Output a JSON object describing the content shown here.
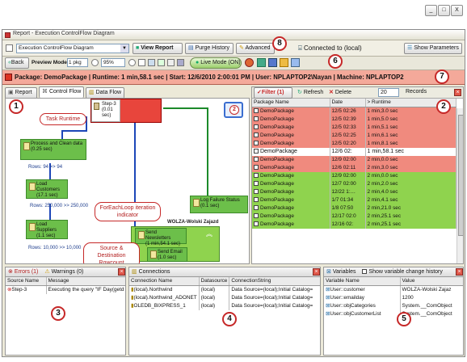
{
  "window_controls": {
    "minimize": "_",
    "maximize": "□",
    "close": "X"
  },
  "window": {
    "title": "Report - Execution ControlFlow Diagram"
  },
  "toolbar1": {
    "report_select": "Execution ControlFlow Diagram",
    "view_report": "View Report",
    "purge_history": "Purge History",
    "advanced": "Advanced",
    "connected": "Connected to (local)",
    "show_parameters": "Show Parameters"
  },
  "toolbar2": {
    "back": "Back",
    "preview_mode": "Preview Mode",
    "page_select": "1 pkg",
    "zoom": "95%",
    "live_mode": "Live Mode (ON)"
  },
  "status_bar": {
    "text": "Package: DemoPackage | Runtime: 1 min,58.1 sec | Start: 12/6/2010 2:00:01 PM | User: NPLAPTOP2\\Nayan | Machine: NPLAPTOP2"
  },
  "tabs": [
    {
      "label": "Report"
    },
    {
      "label": "Control Flow"
    },
    {
      "label": "Data Flow"
    }
  ],
  "callouts": {
    "c1": "1",
    "c2": "2",
    "c3": "3",
    "c4": "4",
    "c5": "5",
    "c6": "6",
    "c7": "7",
    "c8": "8"
  },
  "annotations": {
    "task_runtime": "Task Runtime",
    "foreach": "ForEachLoop iteration indicator",
    "rowcount": "Source & Destination Rowcount"
  },
  "diagram": {
    "step3": "Step-3",
    "step3_time": "(0.01 sec)",
    "step3_badge": "2",
    "tasks": [
      {
        "label": "Process and Clean data",
        "time": "(0.25 sec)"
      },
      {
        "label": "Load Customers",
        "time": "(17.1 sec)"
      },
      {
        "label": "Load Suppliers",
        "time": "(1.1 sec)"
      },
      {
        "label": "Log Failure Status",
        "time": "(0.1 sec)"
      },
      {
        "label": "Send Newsletters",
        "time": "(1 min,54.1 sec)"
      },
      {
        "label": "Send Email",
        "time": "(1.0 sec)"
      }
    ],
    "rows1": "Rows: 94 >> 94",
    "rows2": "Rows: 250,000 >> 250,000",
    "rows3": "Rows: 10,000 >> 10,000",
    "foreach_value": "WOLZA-Wolski Zajazd"
  },
  "history": {
    "filter": "Filter (1)",
    "refresh": "Refresh",
    "delete": "Delete",
    "records_count": "20",
    "records_label": "Records",
    "columns": [
      "Package Name",
      "Date",
      "> Runtime"
    ],
    "rows": [
      {
        "name": "DemoPackage",
        "date": "12/5 02:26",
        "runtime": "1 min,3.0 sec",
        "status": "fail"
      },
      {
        "name": "DemoPackage",
        "date": "12/5 02:39",
        "runtime": "1 min,5.0 sec",
        "status": "fail"
      },
      {
        "name": "DemoPackage",
        "date": "12/5 02:33",
        "runtime": "1 min,5.1 sec",
        "status": "fail"
      },
      {
        "name": "DemoPackage",
        "date": "12/5 02:25",
        "runtime": "1 min,6.1 sec",
        "status": "fail"
      },
      {
        "name": "DemoPackage",
        "date": "12/5 02:20",
        "runtime": "1 min,8.1 sec",
        "status": "fail"
      },
      {
        "name": "DemoPackage",
        "date": "12/6 02:",
        "runtime": "1 min,58.1 sec",
        "status": "current"
      },
      {
        "name": "DemoPackage",
        "date": "12/9 02:00",
        "runtime": "2 min,0.0 sec",
        "status": "fail"
      },
      {
        "name": "DemoPackage",
        "date": "12/6 02:11",
        "runtime": "2 min,3.0 sec",
        "status": "fail"
      },
      {
        "name": "DemoPackage",
        "date": "12/9 02:00",
        "runtime": "2 min,0.0 sec",
        "status": "ok"
      },
      {
        "name": "DemoPackage",
        "date": "12/7 02:00",
        "runtime": "2 min,2.0 sec",
        "status": "ok"
      },
      {
        "name": "DemoPackage",
        "date": "12/22 1:…",
        "runtime": "2 min,4.0 sec",
        "status": "ok"
      },
      {
        "name": "DemoPackage",
        "date": "1/7 01:34",
        "runtime": "2 min,4.1 sec",
        "status": "ok"
      },
      {
        "name": "DemoPackage",
        "date": "1/8 07:50",
        "runtime": "2 min,21.0 sec",
        "status": "ok"
      },
      {
        "name": "DemoPackage",
        "date": "12/17 02:0",
        "runtime": "2 min,25.1 sec",
        "status": "ok"
      },
      {
        "name": "DemoPackage",
        "date": "12/16 02:",
        "runtime": "2 min,25.1 sec",
        "status": "ok"
      }
    ]
  },
  "errors": {
    "errors_tab": "Errors (1)",
    "warnings_tab": "Warnings (0)",
    "columns": [
      "Source Name",
      "Message"
    ],
    "rows": [
      {
        "source": "Step-3",
        "message": "Executing the query \"IF Day(getd"
      }
    ]
  },
  "connections": {
    "title": "Connections",
    "columns": [
      "Connection Name",
      "Datasource",
      "ConnectionString"
    ],
    "rows": [
      {
        "name": "(local).Northwind",
        "ds": "(local)",
        "cs": "Data Source=(local);Initial Catalog="
      },
      {
        "name": "(local).Northwind_ADONET",
        "ds": "(local)",
        "cs": "Data Source=(local);Initial Catalog="
      },
      {
        "name": "OLEDB_BIXPRESS_1",
        "ds": "(local)",
        "cs": "Data Source=(local);Initial Catalog="
      }
    ]
  },
  "variables": {
    "title": "Variables",
    "history_check": "Show variable change history",
    "columns": [
      "Variable Name",
      "Value"
    ],
    "rows": [
      {
        "name": "User::customer",
        "value": "WOLZA-Wolski  Zajaz"
      },
      {
        "name": "User::emailday",
        "value": "1200"
      },
      {
        "name": "User::objCategories",
        "value": "System.__ComObject"
      },
      {
        "name": "User::objCustomerList",
        "value": "System.__ComObject"
      }
    ]
  },
  "colors": {
    "fail": "#f08a7e",
    "ok": "#8fd34e",
    "accent": "#c62828"
  }
}
